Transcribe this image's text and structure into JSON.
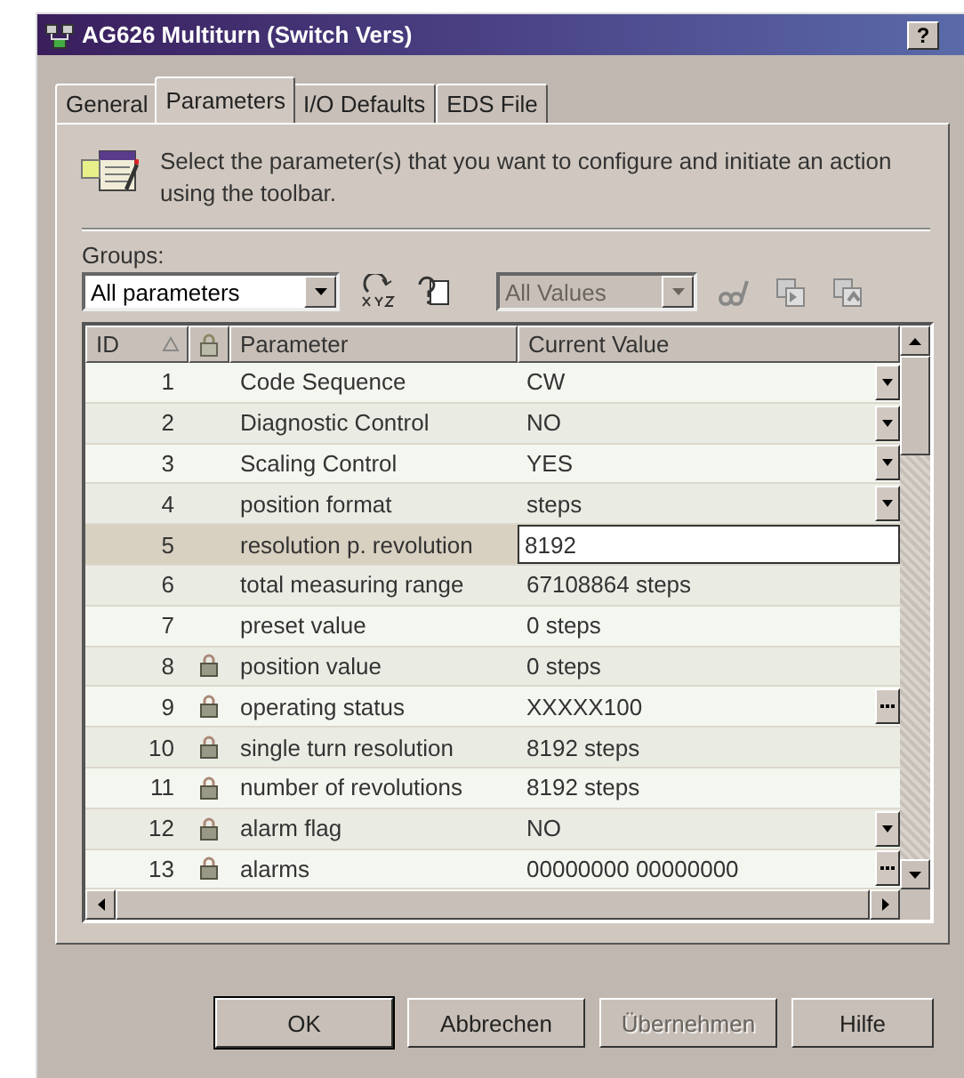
{
  "window": {
    "title": "AG626 Multiturn (Switch Vers)",
    "help_button": "?"
  },
  "tabs": [
    {
      "label": "General",
      "selected": false
    },
    {
      "label": "Parameters",
      "selected": true
    },
    {
      "label": "I/O Defaults",
      "selected": false
    },
    {
      "label": "EDS File",
      "selected": false
    }
  ],
  "intro": "Select the parameter(s) that you want to configure and initiate an action using the toolbar.",
  "groups": {
    "label": "Groups:",
    "value": "All parameters"
  },
  "values_filter": {
    "value": "All Values",
    "disabled": true
  },
  "table": {
    "columns": [
      "ID",
      "Parameter",
      "Current Value"
    ],
    "rows": [
      {
        "id": "1",
        "locked": false,
        "parameter": "Code Sequence",
        "value": "CW",
        "kind": "dropdown",
        "selected": false
      },
      {
        "id": "2",
        "locked": false,
        "parameter": "Diagnostic Control",
        "value": "NO",
        "kind": "dropdown",
        "selected": false
      },
      {
        "id": "3",
        "locked": false,
        "parameter": "Scaling Control",
        "value": "YES",
        "kind": "dropdown",
        "selected": false
      },
      {
        "id": "4",
        "locked": false,
        "parameter": "position format",
        "value": "steps",
        "kind": "dropdown",
        "selected": false
      },
      {
        "id": "5",
        "locked": false,
        "parameter": "resolution p. revolution",
        "value": "8192",
        "kind": "edit",
        "selected": true
      },
      {
        "id": "6",
        "locked": false,
        "parameter": "total measuring range",
        "value": "67108864 steps",
        "kind": "plain",
        "selected": false
      },
      {
        "id": "7",
        "locked": false,
        "parameter": "preset value",
        "value": "0 steps",
        "kind": "plain",
        "selected": false
      },
      {
        "id": "8",
        "locked": true,
        "parameter": "position value",
        "value": "0 steps",
        "kind": "plain",
        "selected": false
      },
      {
        "id": "9",
        "locked": true,
        "parameter": "operating status",
        "value": "XXXXX100",
        "kind": "ellipsis",
        "selected": false
      },
      {
        "id": "10",
        "locked": true,
        "parameter": "single turn resolution",
        "value": "8192 steps",
        "kind": "plain",
        "selected": false
      },
      {
        "id": "11",
        "locked": true,
        "parameter": "number of revolutions",
        "value": "8192 steps",
        "kind": "plain",
        "selected": false
      },
      {
        "id": "12",
        "locked": true,
        "parameter": "alarm flag",
        "value": "NO",
        "kind": "dropdown",
        "selected": false
      },
      {
        "id": "13",
        "locked": true,
        "parameter": "alarms",
        "value": "00000000 00000000",
        "kind": "ellipsis",
        "selected": false
      }
    ]
  },
  "buttons": [
    {
      "label": "OK",
      "disabled": false
    },
    {
      "label": "Abbrechen",
      "disabled": false
    },
    {
      "label": "Übernehmen",
      "disabled": true
    },
    {
      "label": "Hilfe",
      "disabled": false
    }
  ]
}
